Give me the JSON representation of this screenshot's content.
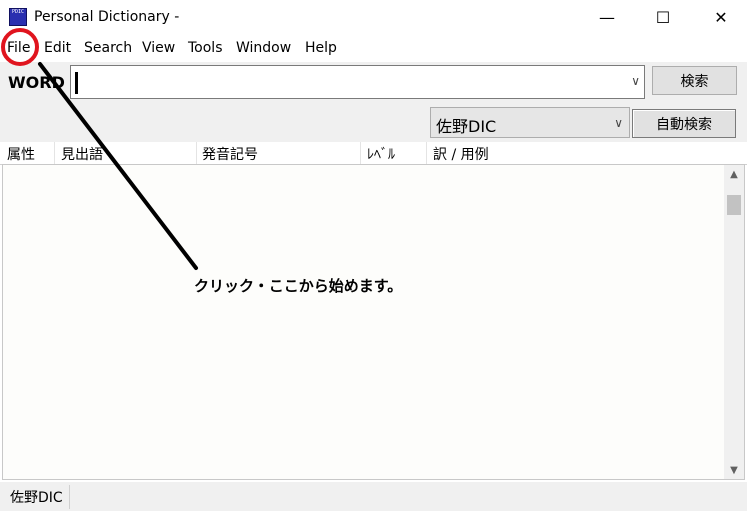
{
  "window": {
    "title": "Personal Dictionary -",
    "icon_text": "PDIC",
    "minimize_glyph": "—",
    "maximize_glyph": "☐",
    "close_glyph": "✕"
  },
  "menu": [
    "File",
    "Edit",
    "Search",
    "View",
    "Tools",
    "Window",
    "Help"
  ],
  "search": {
    "label": "WORD",
    "value": "",
    "button_label": "検索"
  },
  "options": {
    "dictionary_selected": "佐野DIC",
    "auto_search_label": "自動検索"
  },
  "list": {
    "columns": [
      "属性",
      "見出語",
      "発音記号",
      "ﾚﾍﾞﾙ",
      "訳 / 用例"
    ]
  },
  "annotation": {
    "text": "クリック・ここから始めます。",
    "highlight_color": "#e0141e"
  },
  "status": {
    "dictionary": "佐野DIC"
  }
}
